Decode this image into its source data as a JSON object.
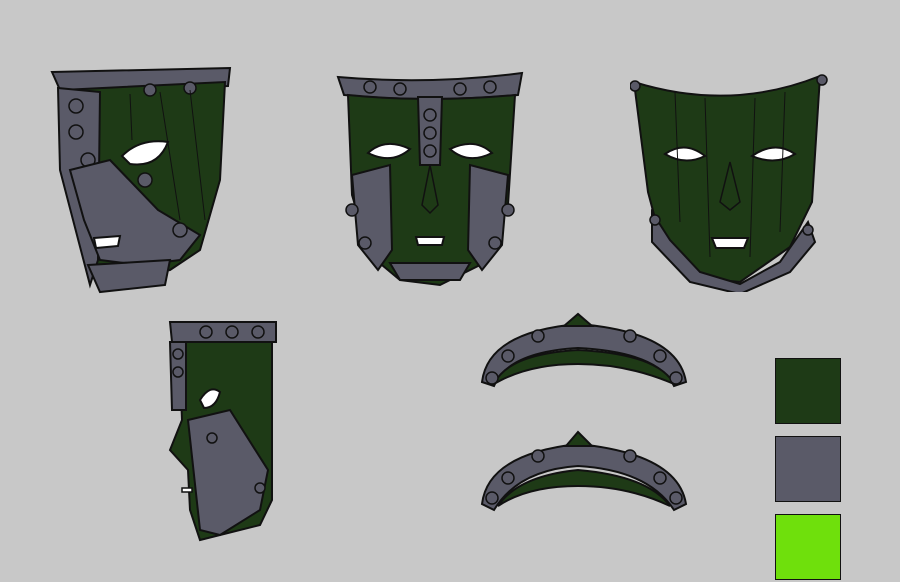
{
  "colors": {
    "background": "#c8c8c8",
    "mask_green": "#1e3a16",
    "metal_gray": "#5a5a68",
    "outline": "#0e0e0e",
    "accent_green": "#6fe00c"
  },
  "palette": [
    {
      "name": "mask-green",
      "hex": "#1e3a16"
    },
    {
      "name": "metal-gray",
      "hex": "#5a5a68"
    },
    {
      "name": "accent-green",
      "hex": "#6fe00c"
    }
  ]
}
